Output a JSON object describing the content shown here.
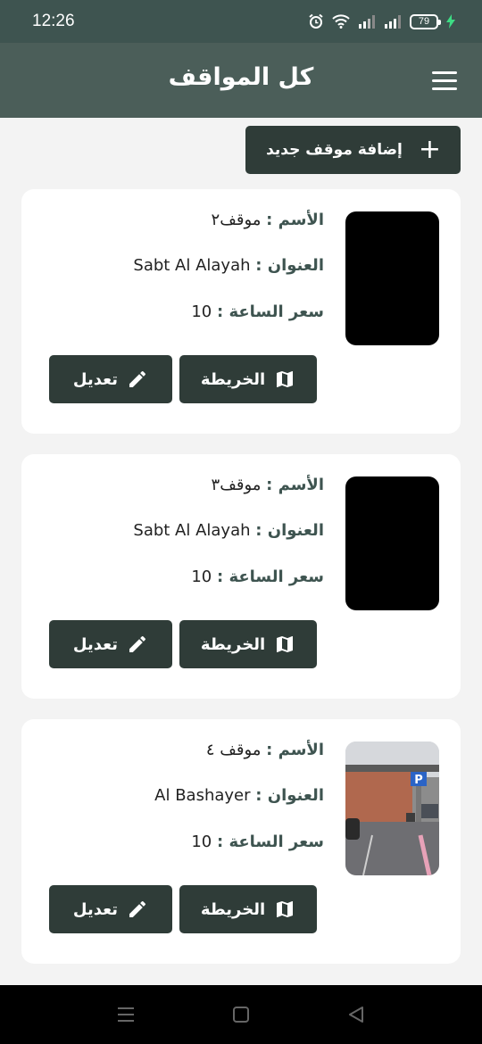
{
  "status_bar": {
    "time": "12:26",
    "battery": "79"
  },
  "app_bar": {
    "title": "كل المواقف",
    "menu_icon": "hamburger-menu-icon"
  },
  "add_button": {
    "label": "إضافة موقف جديد",
    "icon": "plus-icon"
  },
  "field_labels": {
    "name": "الأسم :",
    "address": "العنوان :",
    "price": "سعر الساعة :"
  },
  "buttons": {
    "map_label": "الخريطة",
    "map_icon": "map-icon",
    "edit_label": "تعديل",
    "edit_icon": "pencil-icon"
  },
  "parkings": [
    {
      "name": "موقف٢",
      "address": "Sabt Al Alayah",
      "price": "10"
    },
    {
      "name": "موقف٣",
      "address": "Sabt Al Alayah",
      "price": "10"
    },
    {
      "name": "موقف ٤",
      "address": "Al Bashayer",
      "price": "10"
    }
  ],
  "nav_bar": {
    "icons": [
      "recent-apps-icon",
      "home-icon",
      "back-icon"
    ]
  },
  "colors": {
    "app_bar": "#4b5e59",
    "status_bar": "#3e5450",
    "button": "#2f3c38",
    "background": "#f3f3f3"
  }
}
